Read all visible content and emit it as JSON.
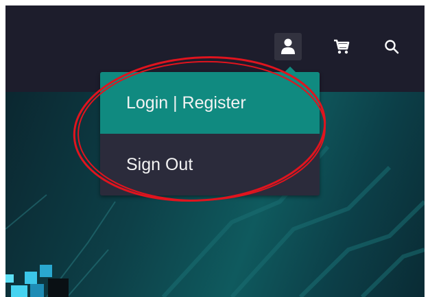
{
  "header": {
    "icons": {
      "user": "user-icon",
      "cart": "cart-icon",
      "search": "search-icon"
    }
  },
  "account_menu": {
    "items": [
      {
        "label": "Login | Register"
      },
      {
        "label": "Sign Out"
      }
    ]
  },
  "colors": {
    "header_bg": "#1d1d2c",
    "menu_bg": "#2b2b3b",
    "menu_active": "#108a80",
    "annotation": "#e0141e"
  }
}
